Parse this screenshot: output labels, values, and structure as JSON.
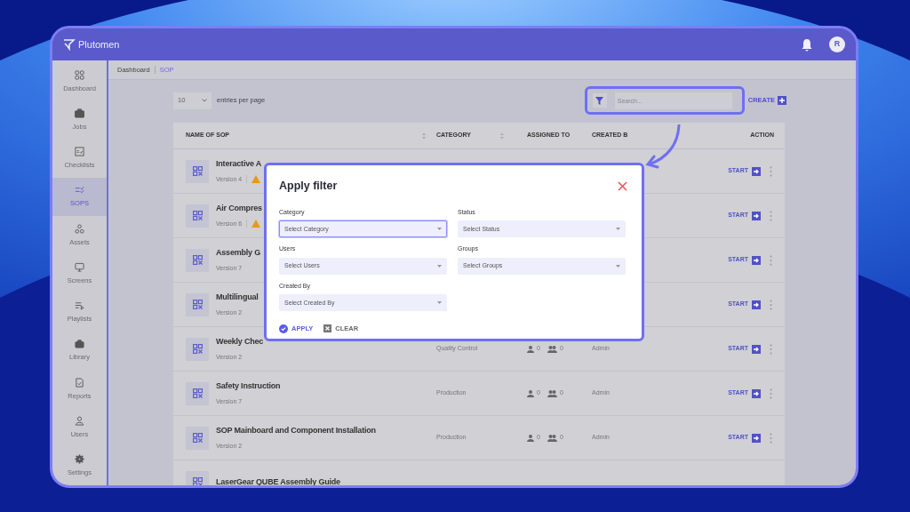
{
  "app": {
    "logo": "Plutomen",
    "avatar": "R"
  },
  "sidebar": [
    {
      "label": "Dashboard",
      "selected": false
    },
    {
      "label": "Jobs",
      "selected": false
    },
    {
      "label": "Checklists",
      "selected": false
    },
    {
      "label": "SOPS",
      "selected": true
    },
    {
      "label": "Assets",
      "selected": false
    },
    {
      "label": "Screens",
      "selected": false
    },
    {
      "label": "Playlists",
      "selected": false
    },
    {
      "label": "Library",
      "selected": false
    },
    {
      "label": "Reports",
      "selected": false
    },
    {
      "label": "Users",
      "selected": false
    },
    {
      "label": "Settings",
      "selected": false
    }
  ],
  "breadcrumb": [
    {
      "label": "Dashboard",
      "selected": false
    },
    {
      "label": "SOP",
      "selected": true
    }
  ],
  "entries": {
    "value": "10",
    "label": "entries per page"
  },
  "search": {
    "placeholder": "Search..."
  },
  "create_button": "CREATE",
  "table": {
    "columns": [
      "NAME OF SOP",
      "CATEGORY",
      "ASSIGNED TO",
      "CREATED B",
      "ACTION"
    ],
    "rows": [
      {
        "name": "Interactive A",
        "version": "Version 4",
        "warning": true,
        "action": "START"
      },
      {
        "name": "Air Compres",
        "version": "Version 6",
        "warning": true,
        "action": "START"
      },
      {
        "name": "Assembly G",
        "version": "Version 7",
        "warning": false,
        "action": "START"
      },
      {
        "name": "Multilingual",
        "version": "Version 2",
        "warning": false,
        "action": "START"
      },
      {
        "name": "Weekly Chec",
        "version": "Version 2",
        "warning": false,
        "category": "Quality Control",
        "users": "0",
        "groups": "0",
        "created_by": "Admin",
        "action": "START"
      },
      {
        "name": "Safety Instruction",
        "version": "Version 7",
        "warning": false,
        "category": "Production",
        "users": "0",
        "groups": "0",
        "created_by": "Admin",
        "action": "START"
      },
      {
        "name": "SOP Mainboard and Component Installation",
        "version": "Version 2",
        "warning": false,
        "category": "Production",
        "users": "0",
        "groups": "0",
        "created_by": "Admin",
        "action": "START"
      },
      {
        "name": "LaserGear QUBE Assembly Guide",
        "warning": false
      }
    ]
  },
  "filter_dialog": {
    "title": "Apply filter",
    "fields": [
      {
        "label": "Category",
        "placeholder": "Select Category",
        "focused": true
      },
      {
        "label": "Status",
        "placeholder": "Select Status",
        "focused": false
      },
      {
        "label": "Users",
        "placeholder": "Select Users",
        "focused": false
      },
      {
        "label": "Groups",
        "placeholder": "Select Groups",
        "focused": false
      },
      {
        "label": "Created By",
        "placeholder": "Select Created By",
        "focused": false
      }
    ],
    "apply": "APPLY",
    "clear": "CLEAR"
  }
}
